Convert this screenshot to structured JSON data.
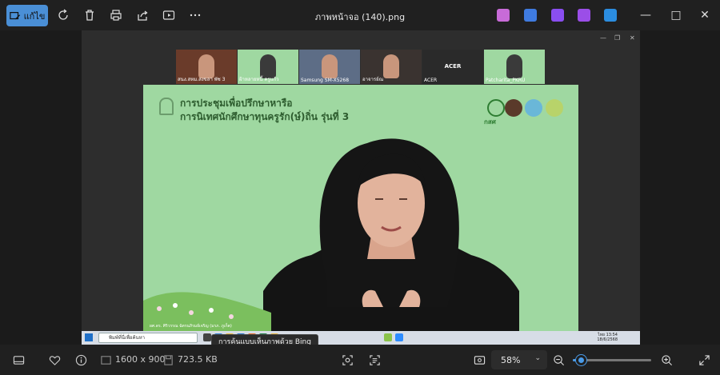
{
  "toolbar": {
    "edit_label": "แก้ไข",
    "file_title": "ภาพหน้าจอ (140).png",
    "icons": [
      "rotate-icon",
      "delete-icon",
      "print-icon",
      "share-icon",
      "slideshow-icon",
      "more-icon"
    ],
    "app_icons": [
      {
        "name": "copilot-icon",
        "color": "#c86bd8"
      },
      {
        "name": "designer-icon",
        "color": "#3f7be0"
      },
      {
        "name": "clipchamp-icon",
        "color": "#8a4ef0"
      },
      {
        "name": "photos-edit-icon",
        "color": "#9b4ee8"
      },
      {
        "name": "onedrive-icon",
        "color": "#2b8de0"
      }
    ]
  },
  "screenshot": {
    "participants": [
      {
        "name": "สนง.สหม.สงขลา พัช 3",
        "color": "#6a3b2a",
        "kind": "person"
      },
      {
        "name": "ฝ้าหลายหนี้ ครูแก้ว",
        "color": "#9fd8a1",
        "kind": "person"
      },
      {
        "name": "Samsung SM-X5268",
        "color": "#5d6d86",
        "kind": "person"
      },
      {
        "name": "อาจารย์ณ",
        "color": "#3a3330",
        "kind": "person"
      },
      {
        "name": "ACER",
        "color": "#2a2a2a",
        "kind": "label",
        "label": "ACER"
      },
      {
        "name": "Patcharita_PKRU",
        "color": "#9fd8a1",
        "kind": "person"
      }
    ],
    "slide": {
      "title_line1": "การประชุมเพื่อปรึกษาหารือ",
      "title_line2": "การนิเทศนักศึกษาทุนครูรัก(ษ์)ถิ่น รุ่นที่ 3",
      "logo_text": "กสศ",
      "speaker_caption": "ผศ.ดร. ศิริวรรณ ฉัตรนภิรมย์เจริญ (มรภ. ภูเก็ต)"
    },
    "taskbar": {
      "search_placeholder": "พิมพ์ที่นี่เพื่อค้นหา",
      "time": "13:54",
      "date": "18/6/2568",
      "status_text": "ไทย"
    },
    "tooltip": "การค้นแบบเห็นภาพด้วย Bing"
  },
  "bottom": {
    "dimensions": "1600 x 900",
    "file_size": "723.5 KB",
    "zoom": "58%",
    "zoom_level": 0.1
  }
}
